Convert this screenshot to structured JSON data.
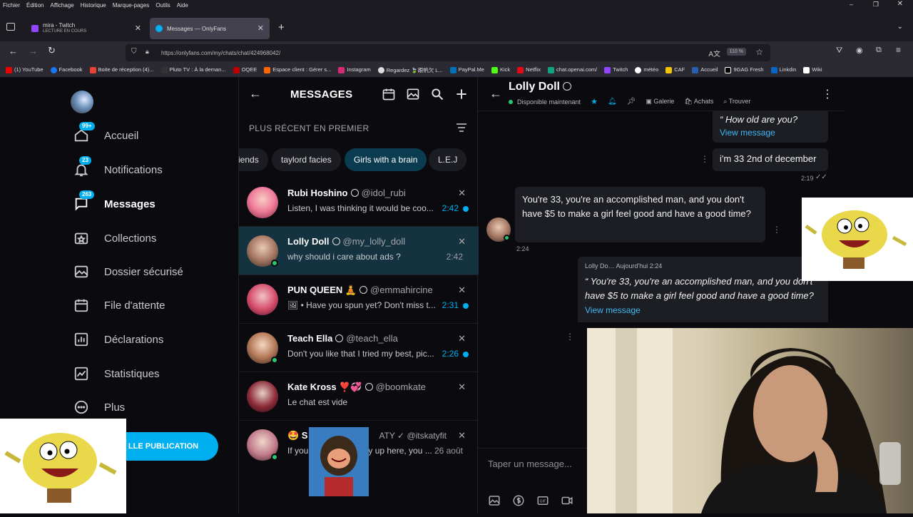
{
  "menubar": [
    "Fichier",
    "Édition",
    "Affichage",
    "Historique",
    "Marque-pages",
    "Outils",
    "Aide"
  ],
  "tabs": [
    {
      "title": "mira - Twitch",
      "subtitle": "LECTURE EN COURS",
      "active": false
    },
    {
      "title": "Messages — OnlyFans",
      "active": true
    }
  ],
  "url": "https://onlyfans.com/my/chats/chat/424968042/",
  "zoom": "110 %",
  "bookmarks": [
    "(1) YouTube",
    "Facebook",
    "Boite de réception (4)...",
    "Pluto TV : À la deman...",
    "OQEE",
    "Espace client : Gérer s...",
    "Instagram",
    "Regardez 🍃跟帆欠 L...",
    "PayPal.Me",
    "Kick",
    "Netflix",
    "chat.openai.com/",
    "Twitch",
    "météo",
    "CAF",
    "Accueil",
    "9GAG Fresh",
    "Linkdin",
    "Wiki"
  ],
  "nav": {
    "items": [
      {
        "label": "Accueil",
        "badge": "99+"
      },
      {
        "label": "Notifications",
        "badge": "23"
      },
      {
        "label": "Messages",
        "badge": "263"
      },
      {
        "label": "Collections",
        "badge": ""
      },
      {
        "label": "Dossier sécurisé",
        "badge": ""
      },
      {
        "label": "File d'attente",
        "badge": ""
      },
      {
        "label": "Déclarations",
        "badge": ""
      },
      {
        "label": "Statistiques",
        "badge": ""
      },
      {
        "label": "Plus",
        "badge": ""
      }
    ],
    "new_post": "LLE PUBLICATION"
  },
  "messages": {
    "title": "MESSAGES",
    "sort": "PLUS RÉCENT EN PREMIER",
    "chips": [
      "iends",
      "taylord facies",
      "Girls with a brain",
      "L.E.J"
    ],
    "conversations": [
      {
        "name": "Rubi Hoshino",
        "handle": "@idol_rubi",
        "preview": "Listen, I was thinking it would be coo...",
        "time": "2:42",
        "unread": true,
        "online": false
      },
      {
        "name": "Lolly Doll",
        "handle": "@my_lolly_doll",
        "preview": "why should i care about ads ?",
        "time": "2:42",
        "unread": false,
        "online": true
      },
      {
        "name": "PUN QUEEN 🧘",
        "handle": "@emmahircine",
        "preview": "🖼 • Have you spun yet? Don't miss t...",
        "time": "2:31",
        "unread": true,
        "online": false
      },
      {
        "name": "Teach Ella",
        "handle": "@teach_ella",
        "preview": "Don't you like that I tried my best, pic...",
        "time": "2:26",
        "unread": true,
        "online": true
      },
      {
        "name": "Kate Kross ❣️💞",
        "handle": "@boomkate",
        "preview": "Le chat est vide",
        "time": "",
        "unread": false,
        "online": false
      },
      {
        "name": "🤩 S",
        "handle": "ATY ✓ @itskatyfit",
        "preview": "If you",
        "preview2": "y up here, you ...",
        "time": "26 août",
        "unread": false,
        "online": true
      }
    ]
  },
  "chat": {
    "name": "Lolly Doll",
    "status": "Disponible maintenant",
    "toolbar": [
      "Galerie",
      "Achats",
      "Trouver"
    ],
    "quote_top": "“ How old are you?",
    "view_message": "View message",
    "my_message": "i'm 33 2nd of december",
    "my_time": "2:19",
    "their_message": "You're 33, you're an accomplished man, and you don't have $5 to make a girl feel good and have a good time?",
    "their_time": "2:24",
    "quote_meta": "Lolly Do… Aujourd'hui 2:24",
    "quote_body": "“ You're 33, you're an accomplished man, and you don't have $5 to make a girl feel good and have a good time?",
    "composer_placeholder": "Taper un message..."
  },
  "colors": {
    "accent": "#00aff0",
    "online": "#28c76f",
    "active_row": "#14323f"
  }
}
